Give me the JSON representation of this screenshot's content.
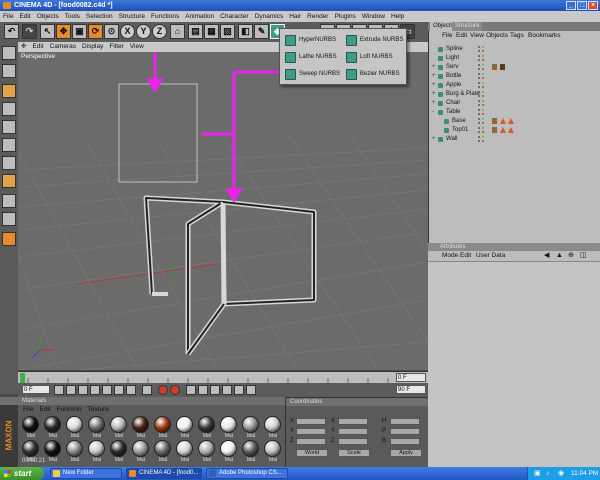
{
  "window": {
    "title": "CINEMA 4D - [food0082.c4d *]",
    "controls": [
      "_",
      "□",
      "×"
    ]
  },
  "menubar": [
    "File",
    "Edit",
    "Objects",
    "Tools",
    "Selection",
    "Structure",
    "Functions",
    "Animation",
    "Character",
    "Dynamics",
    "Hair",
    "Render",
    "Plugins",
    "Window",
    "Help"
  ],
  "viewport": {
    "menu": [
      "Edit",
      "Cameras",
      "Display",
      "Filter",
      "View"
    ],
    "label": "Perspective"
  },
  "nurbs_menu": {
    "items": [
      "HyperNURBS",
      "Extrude NURBS",
      "Lathe NURBS",
      "Loft NURBS",
      "Sweep NURBS",
      "Bezier NURBS"
    ]
  },
  "object_manager": {
    "tabs": [
      "Objects",
      "Structure"
    ],
    "menu": [
      "File",
      "Edit",
      "View",
      "Objects",
      "Tags",
      "Bookmarks"
    ],
    "objects": [
      {
        "name": "Spline",
        "indent": 1,
        "expander": ""
      },
      {
        "name": "Light",
        "indent": 1,
        "expander": ""
      },
      {
        "name": "Serv",
        "indent": 1,
        "expander": "+"
      },
      {
        "name": "Bottle",
        "indent": 1,
        "expander": "+"
      },
      {
        "name": "Apple",
        "indent": 1,
        "expander": "+"
      },
      {
        "name": "Burg & Plate",
        "indent": 1,
        "expander": "+"
      },
      {
        "name": "Chair",
        "indent": 1,
        "expander": "+"
      },
      {
        "name": "Table",
        "indent": 1,
        "expander": "-"
      },
      {
        "name": "Base",
        "indent": 2,
        "expander": ""
      },
      {
        "name": "Top01",
        "indent": 2,
        "expander": ""
      },
      {
        "name": "Wall",
        "indent": 1,
        "expander": "+"
      }
    ]
  },
  "attributes": {
    "title": "Attributes",
    "menu": [
      "Mode",
      "Edit",
      "User Data"
    ]
  },
  "timeline": {
    "start_field": "0 F",
    "end_field": "90 F",
    "current_field": "0 F",
    "max_field": "90 F"
  },
  "materials": {
    "title": "Materials",
    "menu": [
      "File",
      "Edit",
      "Function",
      "Texture"
    ],
    "timecode": "00:00:21",
    "swatches": [
      {
        "label": "Mat",
        "color": "#111111"
      },
      {
        "label": "Mat",
        "color": "#2a2a2a"
      },
      {
        "label": "Mat",
        "color": "#dcdcdc"
      },
      {
        "label": "Mat",
        "color": "#6f6f6f"
      },
      {
        "label": "Mat",
        "color": "#b8b8b8"
      },
      {
        "label": "Mat",
        "color": "#4a2212"
      },
      {
        "label": "Mat",
        "color": "#a03a12"
      },
      {
        "label": "Mat",
        "color": "#f0f0ee"
      },
      {
        "label": "Mat",
        "color": "#3a3a3a"
      },
      {
        "label": "Mat",
        "color": "#e8e8e8"
      },
      {
        "label": "Mat",
        "color": "#9a9a9a"
      },
      {
        "label": "Mat",
        "color": "#cfcfcf"
      },
      {
        "label": "Mat",
        "color": "#333333"
      },
      {
        "label": "Mat",
        "color": "#111111"
      },
      {
        "label": "Mat",
        "color": "#8a8a8a"
      },
      {
        "label": "Mat",
        "color": "#c8c8c8"
      },
      {
        "label": "Mat",
        "color": "#2b2b2b"
      },
      {
        "label": "Mat",
        "color": "#9c9c9c"
      },
      {
        "label": "Mat",
        "color": "#6a6a6a"
      },
      {
        "label": "Mat",
        "color": "#d4d4d4"
      },
      {
        "label": "Mat",
        "color": "#b0b0b0"
      },
      {
        "label": "Mat",
        "color": "#f2f2f2"
      },
      {
        "label": "Mat",
        "color": "#5b5b5b"
      },
      {
        "label": "Mat",
        "color": "#c0c0c0"
      }
    ]
  },
  "coordinates": {
    "title": "Coordinates",
    "rows": [
      "X",
      "Y",
      "Z"
    ],
    "size_rows": [
      "H",
      "P",
      "B"
    ],
    "mode_button": "World",
    "scale_button": "Scale",
    "apply_button": "Apply"
  },
  "taskbar": {
    "start": "start",
    "tasks": [
      "New Folder",
      "CINEMA 4D - [food0...",
      "Adobe Photoshop CS..."
    ],
    "clock": "11:04 PM"
  },
  "accent_colors": {
    "arrow": "#ee22ee",
    "cinema_orange": "#e88a2a",
    "nurbs_green": "#3f9c88"
  }
}
